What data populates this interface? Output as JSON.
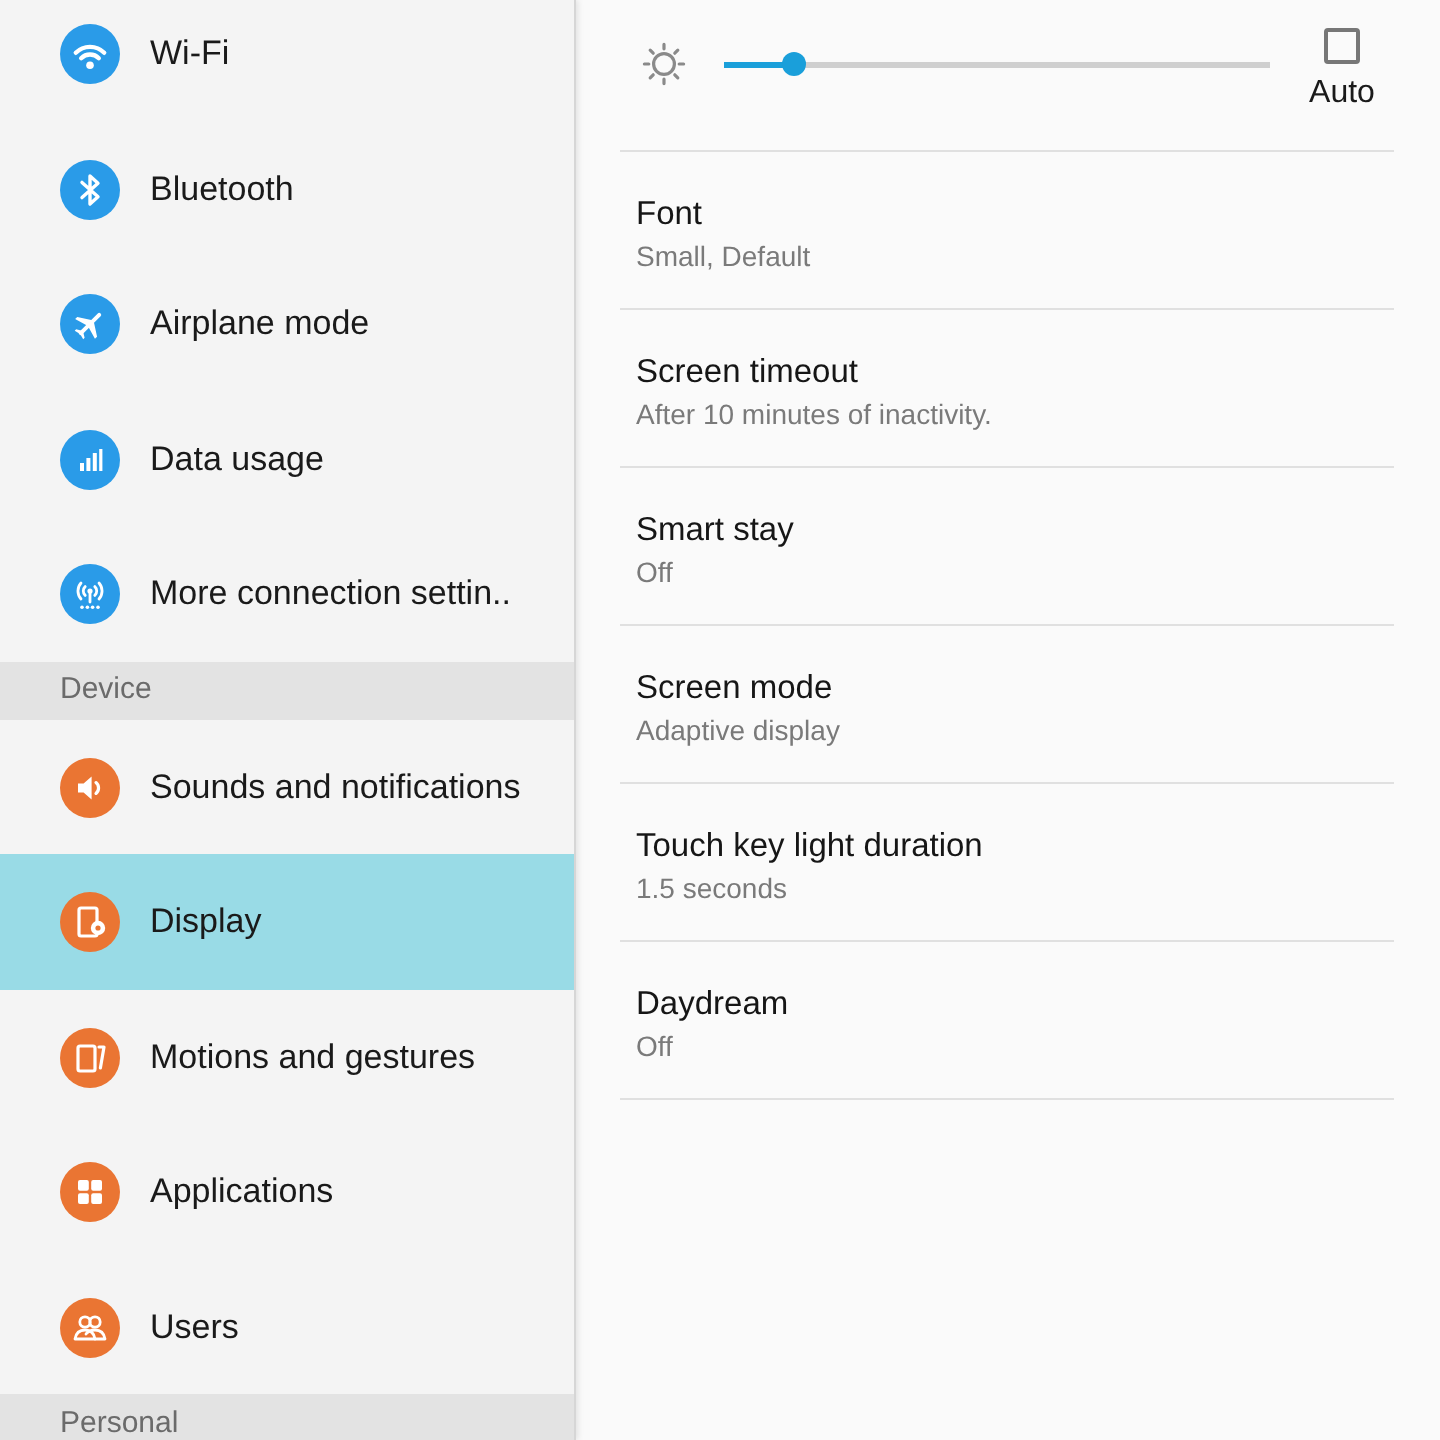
{
  "sidebar": {
    "sections": [
      {
        "color": "#2a9be8",
        "items": [
          {
            "label": "Wi-Fi",
            "selected": false
          },
          {
            "label": "Bluetooth",
            "selected": false
          },
          {
            "label": "Airplane mode",
            "selected": false
          },
          {
            "label": "Data usage",
            "selected": false
          },
          {
            "label": "More connection settin..",
            "selected": false
          }
        ]
      },
      {
        "header": "Device",
        "color": "#ea7533",
        "items": [
          {
            "label": "Sounds and notifications",
            "selected": false
          },
          {
            "label": "Display",
            "selected": true
          },
          {
            "label": "Motions and gestures",
            "selected": false
          },
          {
            "label": "Applications",
            "selected": false
          },
          {
            "label": "Users",
            "selected": false
          }
        ]
      },
      {
        "header": "Personal"
      }
    ]
  },
  "display": {
    "brightness": {
      "level": 0.13,
      "auto": {
        "label": "Auto",
        "checked": false
      }
    },
    "items": [
      {
        "title": "Font",
        "value": "Small, Default"
      },
      {
        "title": "Screen timeout",
        "value": "After 10 minutes of inactivity."
      },
      {
        "title": "Smart stay",
        "value": "Off"
      },
      {
        "title": "Screen mode",
        "value": "Adaptive display"
      },
      {
        "title": "Touch key light duration",
        "value": "1.5 seconds"
      },
      {
        "title": "Daydream",
        "value": "Off"
      }
    ]
  }
}
